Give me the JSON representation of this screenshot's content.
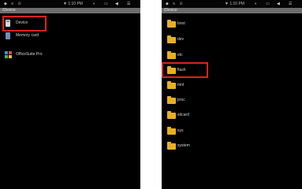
{
  "left_screen": {
    "status": {
      "left": "◆ ≡ ⊙",
      "time": "▼ 1:10 PM",
      "icons": [
        "◐",
        "▭",
        "◀",
        "☰"
      ]
    },
    "path": "/Device",
    "items": [
      {
        "label": "Device",
        "icon": "sd-card-icon"
      },
      {
        "label": "Memory card",
        "icon": "memory-card-icon"
      },
      {
        "label": "OfficeSuite Pro",
        "icon": "officesuite-icon"
      }
    ]
  },
  "right_screen": {
    "status": {
      "left": "◆ ≡ ⊙",
      "time": "▼ 1:10 PM",
      "icons": [
        "◐",
        "▭",
        "◀",
        "☰"
      ]
    },
    "path": "/Device",
    "items": [
      {
        "label": "boot",
        "icon": "folder-icon"
      },
      {
        "label": "dev",
        "icon": "folder-icon"
      },
      {
        "label": "etc",
        "icon": "folder-icon"
      },
      {
        "label": "flash",
        "icon": "folder-icon"
      },
      {
        "label": "mnt",
        "icon": "folder-icon"
      },
      {
        "label": "proc",
        "icon": "folder-icon"
      },
      {
        "label": "sdcard",
        "icon": "folder-icon"
      },
      {
        "label": "sys",
        "icon": "folder-icon"
      },
      {
        "label": "system",
        "icon": "folder-icon"
      }
    ]
  },
  "colors": {
    "highlight": "#e0201e",
    "folder": "#e8b020",
    "background": "#000000"
  }
}
